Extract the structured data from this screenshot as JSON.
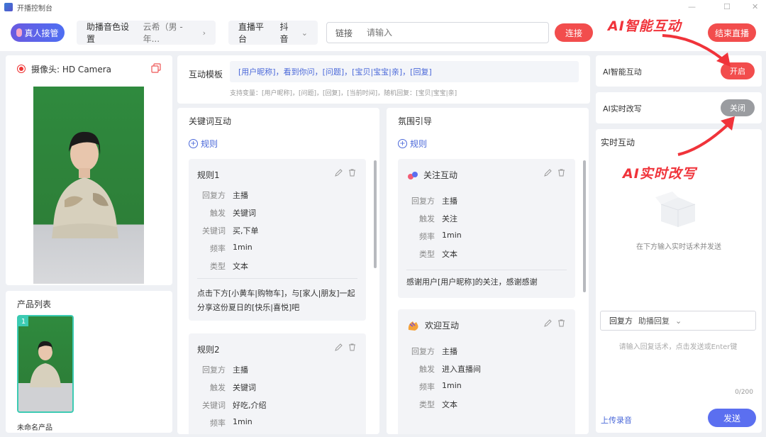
{
  "window": {
    "title": "开播控制台",
    "min": "—",
    "max": "☐",
    "close": "✕"
  },
  "toolbar": {
    "live_host_label": "真人接管",
    "voice_label": "助播音色设置",
    "voice_value": "云希（男 - 年...",
    "platform_label": "直播平台",
    "platform_value": "抖音",
    "link_label": "链接",
    "link_placeholder": "请输入",
    "connect_label": "连接",
    "end_live_label": "结束直播"
  },
  "annotations": {
    "ai_interact": "AI智能互动",
    "ai_rewrite": "AI实时改写"
  },
  "camera": {
    "label": "摄像头: HD Camera"
  },
  "products": {
    "title": "产品列表",
    "items": [
      {
        "index": "1",
        "name": "未命名产品"
      }
    ]
  },
  "template": {
    "label": "互动模板",
    "value": "[用户昵称]，看到你问，[问题]，[宝贝|宝宝|亲]，[回复]",
    "hint": "支持变量：[用户昵称]，[问题]，[回复]，[当前时间]，随机回复：[宝贝|宝宝|亲]"
  },
  "keyword": {
    "title": "关键词互动",
    "add_rule": "规则",
    "cards": [
      {
        "title": "规则1",
        "rows": [
          {
            "k": "回复方",
            "v": "主播"
          },
          {
            "k": "触发",
            "v": "关键词"
          },
          {
            "k": "关键词",
            "v": "买,下单"
          },
          {
            "k": "频率",
            "v": "1min"
          },
          {
            "k": "类型",
            "v": "文本"
          }
        ],
        "text": "点击下方[小黄车|购物车]，与[家人|朋友]一起分享这份夏日的[快乐|喜悦]吧"
      },
      {
        "title": "规则2",
        "rows": [
          {
            "k": "回复方",
            "v": "主播"
          },
          {
            "k": "触发",
            "v": "关键词"
          },
          {
            "k": "关键词",
            "v": "好吃,介绍"
          },
          {
            "k": "频率",
            "v": "1min"
          }
        ]
      }
    ]
  },
  "atmosphere": {
    "title": "氛围引导",
    "add_rule": "规则",
    "cards": [
      {
        "title": "关注互动",
        "rows": [
          {
            "k": "回复方",
            "v": "主播"
          },
          {
            "k": "触发",
            "v": "关注"
          },
          {
            "k": "频率",
            "v": "1min"
          },
          {
            "k": "类型",
            "v": "文本"
          }
        ],
        "text": "感谢用户[用户昵称]的关注，感谢感谢"
      },
      {
        "title": "欢迎互动",
        "rows": [
          {
            "k": "回复方",
            "v": "主播"
          },
          {
            "k": "触发",
            "v": "进入直播间"
          },
          {
            "k": "频率",
            "v": "1min"
          },
          {
            "k": "类型",
            "v": "文本"
          }
        ]
      }
    ]
  },
  "right": {
    "ai_interact_label": "AI智能互动",
    "ai_interact_toggle": "开启",
    "ai_rewrite_label": "AI实时改写",
    "ai_rewrite_toggle": "关闭",
    "realtime_title": "实时互动",
    "empty_hint": "在下方输入实时话术并发送",
    "reply_label": "回复方",
    "reply_value": "助播回复",
    "input_placeholder": "请输入回复话术，点击发送或Enter键",
    "counter": "0/200",
    "upload_label": "上传录音",
    "send_label": "发送"
  },
  "colors": {
    "accent_red": "#f24d4d",
    "accent_blue": "#4a68d9",
    "toggle_off": "#9a9ca0",
    "green_screen": "#2f8a3e"
  }
}
